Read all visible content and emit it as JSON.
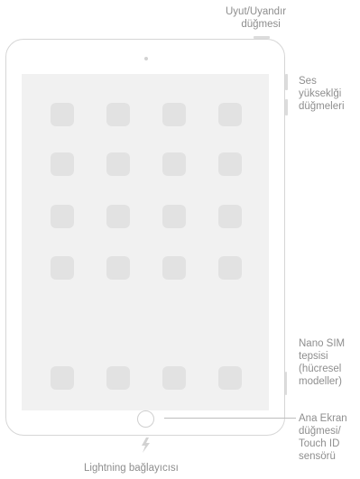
{
  "labels": {
    "sleep_wake": [
      "Uyut/Uyandır",
      "düğmesi"
    ],
    "volume": [
      "Ses",
      "yükseklği",
      "düğmeleri"
    ],
    "nano_sim": [
      "Nano SIM",
      "tepsisi",
      "(hücresel",
      "modeller)"
    ],
    "home_button": [
      "Ana Ekran",
      "düğmesi/",
      "Touch ID",
      "sensörü"
    ],
    "lightning": "Lightning bağlayıcısı"
  },
  "icons": {
    "lightning": "lightning-bolt-icon"
  },
  "colors": {
    "device_outline": "#d6d6d6",
    "screen": "#f1f1f1",
    "app_icon": "#e2e2e2",
    "label_text": "#8e8e8e"
  }
}
